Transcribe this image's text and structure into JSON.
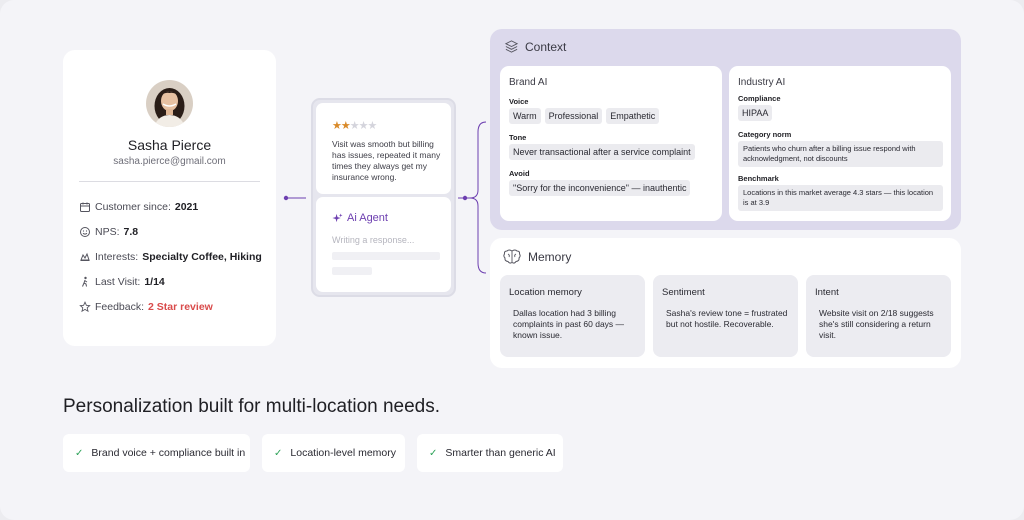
{
  "profile": {
    "name": "Sasha Pierce",
    "email": "sasha.pierce@gmail.com",
    "rows": [
      {
        "icon": "calendar-icon",
        "label": "Customer since:",
        "value": "2021"
      },
      {
        "icon": "smiley-icon",
        "label": "NPS:",
        "value": "7.8"
      },
      {
        "icon": "interests-icon",
        "label": "Interests:",
        "value": "Specialty Coffee, Hiking"
      },
      {
        "icon": "walking-icon",
        "label": "Last Visit:",
        "value": "1/14"
      },
      {
        "icon": "star-outline-icon",
        "label": "Feedback:",
        "value": "2 Star review"
      }
    ]
  },
  "review": {
    "rating": 2,
    "max": 5,
    "text": "Visit was smooth but billing has issues, repeated it many times they always get my insurance wrong."
  },
  "agent": {
    "title": "Ai Agent",
    "placeholder": "Writing a response..."
  },
  "context": {
    "title": "Context",
    "brand": {
      "title": "Brand AI",
      "voice_label": "Voice",
      "voice": [
        "Warm",
        "Professional",
        "Empathetic"
      ],
      "tone_label": "Tone",
      "tone": "Never transactional after a service complaint",
      "avoid_label": "Avoid",
      "avoid": "\"Sorry for the inconvenience\" — inauthentic"
    },
    "industry": {
      "title": "Industry AI",
      "compliance_label": "Compliance",
      "compliance": "HIPAA",
      "category_label": "Category norm",
      "category": "Patients who churn after a billing issue respond with acknowledgment, not discounts",
      "benchmark_label": "Benchmark",
      "benchmark": "Locations in this market average 4.3 stars — this location is at 3.9"
    }
  },
  "memory": {
    "title": "Memory",
    "cards": [
      {
        "title": "Location memory",
        "body": "Dallas location had 3 billing complaints in past 60 days — known issue."
      },
      {
        "title": "Sentiment",
        "body": "Sasha's review tone = frustrated but not hostile. Recoverable."
      },
      {
        "title": "Intent",
        "body": "Website visit on 2/18 suggests she's still considering a return visit."
      }
    ]
  },
  "headline": "Personalization built for multi-location needs.",
  "features": [
    "Brand voice + compliance built in",
    "Location-level memory",
    "Smarter than generic AI"
  ],
  "colors": {
    "accent": "#6d3fb0",
    "star": "#d98a2a",
    "feedback_red": "#d94b4b",
    "check_green": "#2fa35a",
    "context_bg": "#dcd9ec"
  }
}
